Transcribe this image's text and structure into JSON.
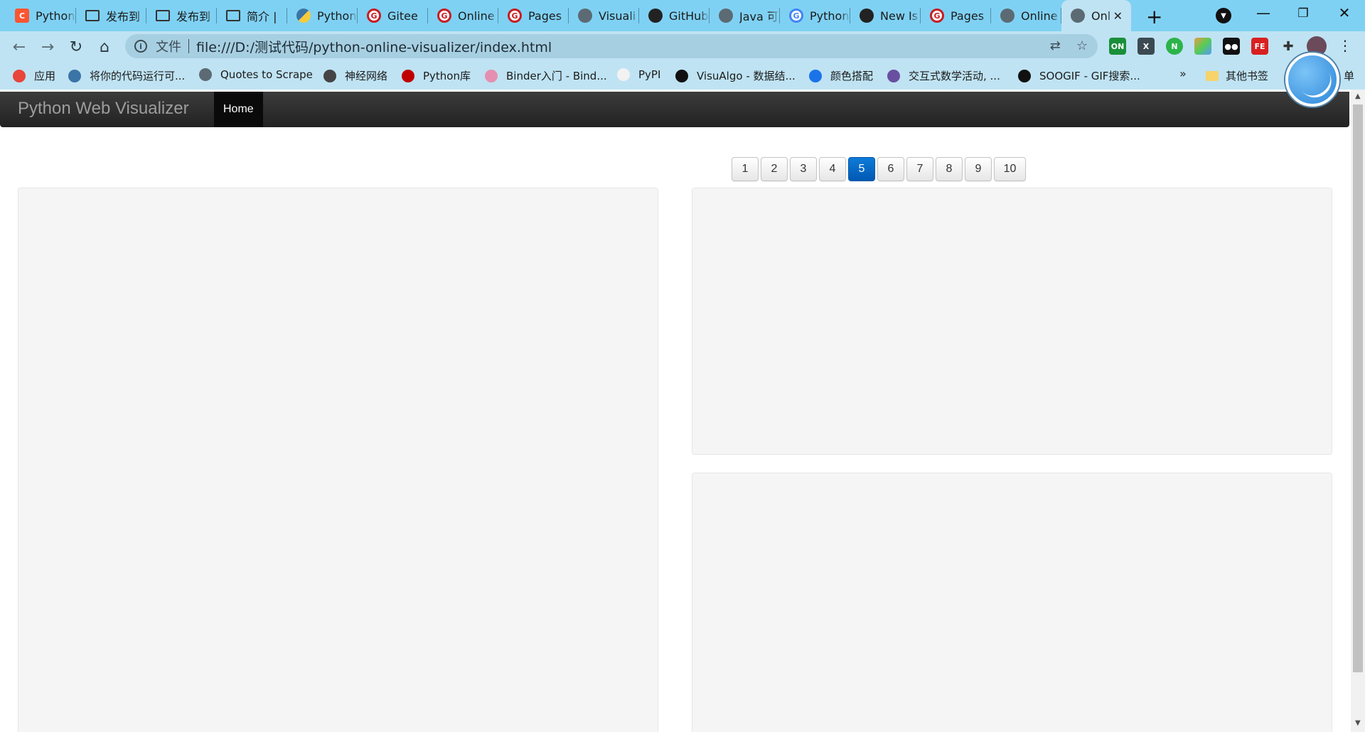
{
  "tabs": [
    {
      "title": "Python",
      "icon": "csdn-icon"
    },
    {
      "title": "发布到",
      "icon": "book-icon"
    },
    {
      "title": "发布到",
      "icon": "book-icon"
    },
    {
      "title": "简介 |",
      "icon": "book-icon"
    },
    {
      "title": "Python",
      "icon": "python-icon"
    },
    {
      "title": "Gitee",
      "icon": "gitee-icon"
    },
    {
      "title": "Online",
      "icon": "gitee-icon"
    },
    {
      "title": "Pages",
      "icon": "gitee-icon"
    },
    {
      "title": "Visuali",
      "icon": "globe-icon"
    },
    {
      "title": "GitHub",
      "icon": "github-icon"
    },
    {
      "title": "Java 可",
      "icon": "globe-icon"
    },
    {
      "title": "Python",
      "icon": "google-icon"
    },
    {
      "title": "New Is",
      "icon": "github-icon"
    },
    {
      "title": "Pages",
      "icon": "gitee-icon"
    },
    {
      "title": "Online",
      "icon": "globe-icon"
    },
    {
      "title": "Onl",
      "icon": "globe-icon"
    }
  ],
  "address": {
    "scheme_label": "文件",
    "url": "file:///D:/测试代码/python-online-visualizer/index.html"
  },
  "bookmarks": [
    {
      "label": "应用",
      "color": "#e8453c"
    },
    {
      "label": "将你的代码运行可...",
      "color": "#3b74a6"
    },
    {
      "label": "Quotes to Scrape",
      "color": "#5c6a73"
    },
    {
      "label": "神经网络",
      "color": "#444444"
    },
    {
      "label": "Python库",
      "color": "#c00000"
    },
    {
      "label": "Binder入门 - Bind...",
      "color": "#e58fb0"
    },
    {
      "label": "PyPI",
      "color": "#f2f2f2"
    },
    {
      "label": "VisuAlgo - 数据结...",
      "color": "#111111"
    },
    {
      "label": "颜色搭配",
      "color": "#1a73e8"
    },
    {
      "label": "交互式数学活动, ...",
      "color": "#6a4fa0"
    },
    {
      "label": "SOOGIF - GIF搜索...",
      "color": "#111111"
    }
  ],
  "bookmarks_more": "»",
  "other_bookmarks": "其他书签",
  "bookmarks_trailing": "单",
  "app": {
    "brand": "Python Web Visualizer",
    "nav_home": "Home"
  },
  "pagination": {
    "pages": [
      "1",
      "2",
      "3",
      "4",
      "5",
      "6",
      "7",
      "8",
      "9",
      "10"
    ],
    "active": "5"
  },
  "colors": {
    "tabstrip": "#7fd1f3",
    "toolbar": "#bfe3f3",
    "navbar": "#222222",
    "active_page": "#0068c9",
    "panel": "#f5f5f5"
  }
}
